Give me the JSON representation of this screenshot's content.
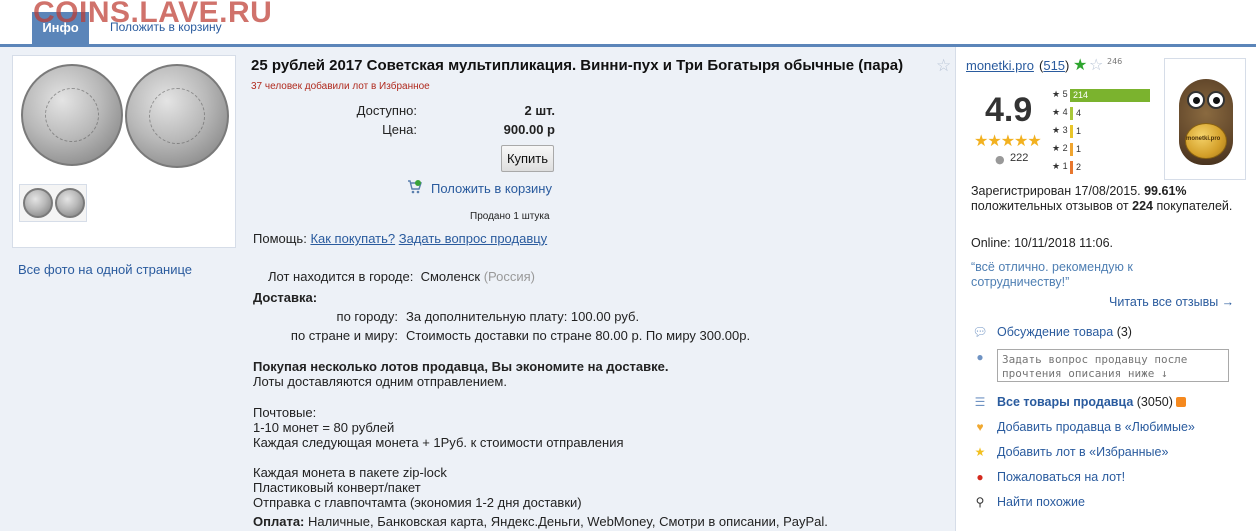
{
  "watermark": "COINS.LAVE.RU",
  "tabs": {
    "info": "Инфо",
    "cart": "Положить в корзину"
  },
  "left": {
    "all_photos": "Все фото на одной странице"
  },
  "lot": {
    "title": "25 рублей 2017 Советская мультипликация. Винни-пух и Три Богатыря обычные (пара)",
    "favorites": "37 человек добавили лот в Избранное",
    "available_label": "Доступно:",
    "available_value": "2 шт.",
    "price_label": "Цена:",
    "price_value": "900.00 р",
    "buy_button": "Купить",
    "cart_link": "Положить в корзину",
    "sold": "Продано 1 штука",
    "help_label": "Помощь:",
    "help_how": "Как покупать?",
    "help_ask": "Задать вопрос продавцу",
    "city_label": "Лот находится в городе:",
    "city": "Смоленск",
    "country": "(Россия)",
    "delivery_title": "Доставка:",
    "delivery_city_label": "по городу:",
    "delivery_city_value": "За дополнительную плату: 100.00 руб.",
    "delivery_world_label": "по стране и миру:",
    "delivery_world_value": "Стоимость доставки по стране 80.00 р. По миру 300.00р.",
    "save_bold": "Покупая несколько лотов продавца, Вы экономите на доставке.",
    "save_note": "Лоты доставляются одним отправлением.",
    "post_lines": [
      "Почтовые:",
      "1-10 монет = 80 рублей",
      "Каждая следующая монета + 1Руб. к стоимости отправления"
    ],
    "pack_lines": [
      "Каждая монета в пакете zip-lock",
      "Пластиковый конверт/пакет",
      "Отправка с главпочтамта (экономия 1-2 дня доставки)"
    ],
    "payment_label": "Оплата:",
    "payment_value": "Наличные, Банковская карта, Яндекс.Деньги, WebMoney, Смотри в описании, PayPal."
  },
  "seller": {
    "name": "monetki.pro",
    "count": "515",
    "star_sup": "246",
    "rating": "4.9",
    "reviews_people": "222",
    "bars": [
      {
        "stars": "★ 5",
        "count": "214",
        "fraction": 1.0,
        "color": "#7bb32e"
      },
      {
        "stars": "★ 4",
        "count": "4",
        "fraction": 0.02,
        "color": "#a9c83a"
      },
      {
        "stars": "★ 3",
        "count": "1",
        "fraction": 0.01,
        "color": "#e9c52a"
      },
      {
        "stars": "★ 2",
        "count": "1",
        "fraction": 0.01,
        "color": "#f0a530"
      },
      {
        "stars": "★ 1",
        "count": "2",
        "fraction": 0.01,
        "color": "#e8772e"
      }
    ],
    "avatar_label": "monetki.pro",
    "registered_prefix": "Зарегистрирован 17/08/2015.",
    "positive_pct": "99.61%",
    "positive_mid": "положительных отзывов от",
    "positive_count": "224",
    "buyers": "покупателей.",
    "online": "Online: 10/11/2018 11:06.",
    "quote": "“всё отлично. рекомендую к сотрудничеству!”",
    "read_all": "Читать все отзывы →",
    "discussion_label": "Обсуждение товара",
    "discussion_count": "(3)",
    "ask_placeholder": "Задать вопрос продавцу после прочтения описания ниже ↓",
    "all_goods_label": "Все товары продавца",
    "all_goods_count": "(3050)",
    "add_fav_seller": "Добавить продавца в «Любимые»",
    "add_fav_lot": "Добавить лот в «Избранные»",
    "complain": "Пожаловаться на лот!",
    "find_similar": "Найти похожие"
  },
  "colors": {
    "accent": "#5b85b9",
    "link": "#2a5b9e",
    "alert": "#b02a1e"
  }
}
